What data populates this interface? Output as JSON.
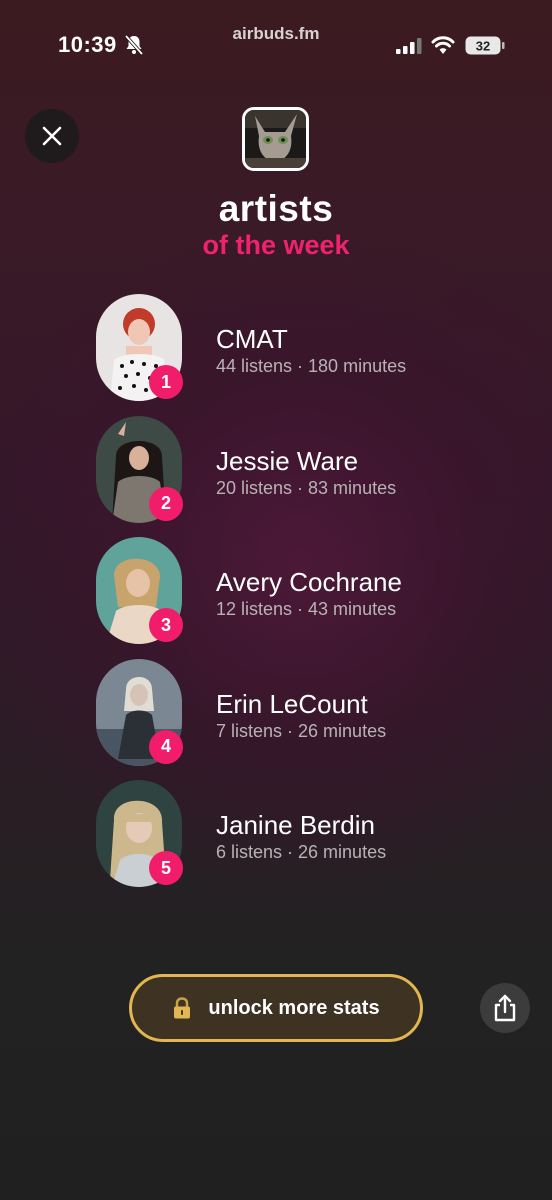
{
  "status_bar": {
    "time": "10:39",
    "url": "airbuds.fm",
    "battery": "32",
    "icons": [
      "bell-slash-icon",
      "signal-icon",
      "wifi-icon",
      "battery-icon"
    ]
  },
  "header": {
    "title": "artists",
    "subtitle": "of the week",
    "accent_color": "#f0226e"
  },
  "artists": [
    {
      "rank": "1",
      "name": "CMAT",
      "stats": "44 listens · 180 minutes"
    },
    {
      "rank": "2",
      "name": "Jessie Ware",
      "stats": "20 listens · 83 minutes"
    },
    {
      "rank": "3",
      "name": "Avery Cochrane",
      "stats": "12 listens · 43 minutes"
    },
    {
      "rank": "4",
      "name": "Erin LeCount",
      "stats": "7 listens · 26 minutes"
    },
    {
      "rank": "5",
      "name": "Janine Berdin",
      "stats": "6 listens · 26 minutes"
    }
  ],
  "footer": {
    "unlock_label": "unlock more stats",
    "unlock_border_color": "#e2b650"
  }
}
